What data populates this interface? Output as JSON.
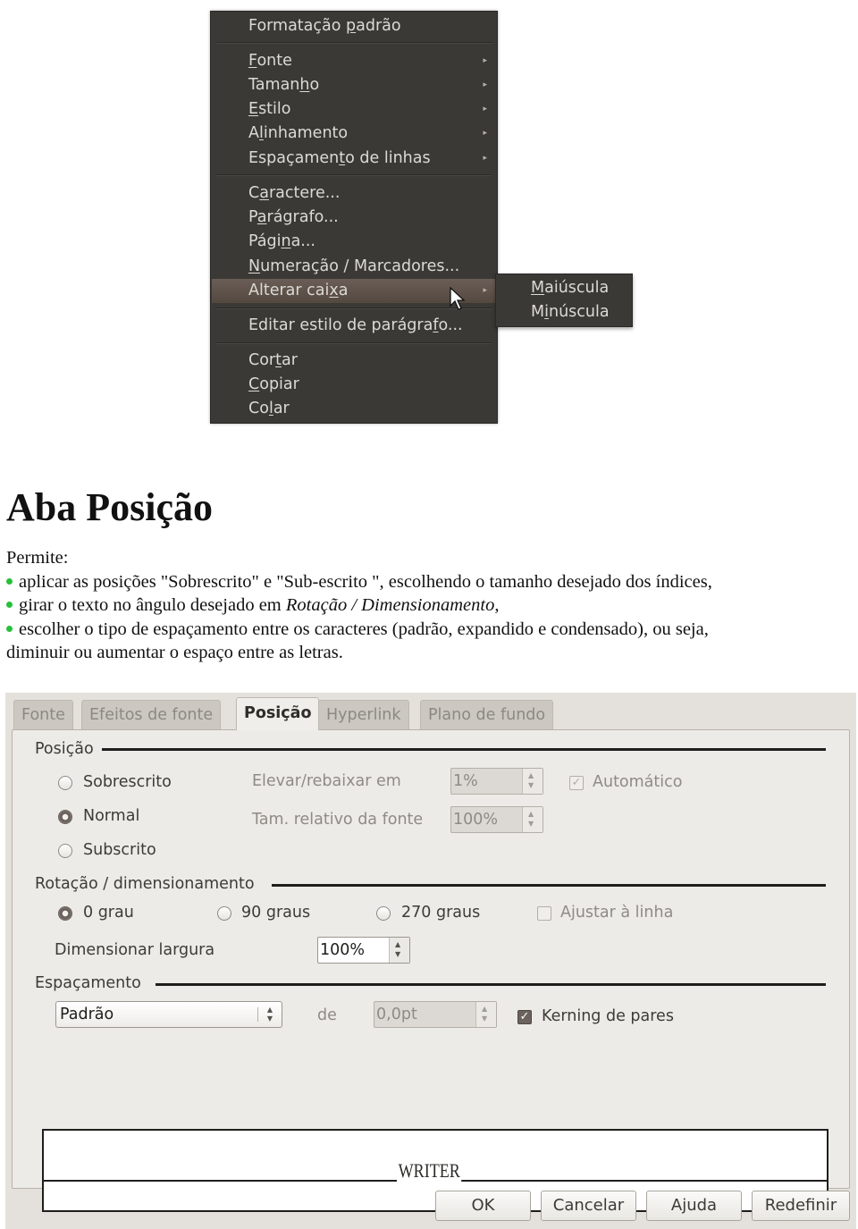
{
  "context_menu": {
    "items": [
      {
        "label": "Formatação padrão",
        "accel_index": 11,
        "submenu": false
      },
      {
        "label": "Fonte",
        "accel_index": 0,
        "submenu": true
      },
      {
        "label": "Tamanho",
        "accel_index": 5,
        "submenu": true
      },
      {
        "label": "Estilo",
        "accel_index": 0,
        "submenu": true
      },
      {
        "label": "Alinhamento",
        "accel_index": 1,
        "submenu": true
      },
      {
        "label": "Espaçamento de linhas",
        "accel_index": 9,
        "submenu": true
      },
      {
        "label": "Caractere...",
        "accel_index": 1,
        "submenu": false
      },
      {
        "label": "Parágrafo...",
        "accel_index": 1,
        "submenu": false
      },
      {
        "label": "Página...",
        "accel_index": 4,
        "submenu": false
      },
      {
        "label": "Numeração / Marcadores...",
        "accel_index": 0,
        "submenu": false
      },
      {
        "label": "Alterar caixa",
        "accel_index": 11,
        "submenu": true,
        "highlighted": true
      },
      {
        "label": "Editar estilo de parágrafo...",
        "accel_index": 24,
        "submenu": false
      },
      {
        "label": "Cortar",
        "accel_index": 3,
        "submenu": false
      },
      {
        "label": "Copiar",
        "accel_index": 0,
        "submenu": false
      },
      {
        "label": "Colar",
        "accel_index": 2,
        "submenu": false
      }
    ],
    "submenu_items": [
      {
        "label": "Maiúscula",
        "accel_index": 0
      },
      {
        "label": "Minúscula",
        "accel_index": 1
      }
    ],
    "arrow_glyph": "▸"
  },
  "document": {
    "title": "Aba Posição",
    "intro": "Permite:",
    "bullets": [
      {
        "text": "aplicar as posições \"Sobrescrito\" e \"Sub-escrito \", escolhendo o tamanho desejado dos índices,"
      },
      {
        "text_before": "girar o texto no ângulo desejado em ",
        "italic": "Rotação / Dimensionamento",
        "text_after": ","
      },
      {
        "text": "escolher o tipo de espaçamento entre os caracteres (padrão, expandido e condensado), ou seja,"
      }
    ],
    "continuation": "diminuir ou aumentar o espaço entre as letras.",
    "bullet_color": "#26c13a"
  },
  "dialog": {
    "tabs": [
      {
        "label": "Fonte",
        "active": false
      },
      {
        "label": "Efeitos de fonte",
        "active": false
      },
      {
        "label": "Posição",
        "active": true
      },
      {
        "label": "Hyperlink",
        "active": false
      },
      {
        "label": "Plano de fundo",
        "active": false
      }
    ],
    "posicao": {
      "group_label": "Posição",
      "radios": [
        {
          "label": "Sobrescrito",
          "checked": false
        },
        {
          "label": "Normal",
          "checked": true
        },
        {
          "label": "Subscrito",
          "checked": false
        }
      ],
      "raise_lower_label": "Elevar/rebaixar em",
      "raise_lower_value": "1%",
      "relative_size_label": "Tam. relativo da fonte",
      "relative_size_value": "100%",
      "automatic_label": "Automático",
      "automatic_checked": true
    },
    "rotacao": {
      "group_label": "Rotação / dimensionamento",
      "radios": [
        {
          "label": "0 grau",
          "checked": true
        },
        {
          "label": "90 graus",
          "checked": false
        },
        {
          "label": "270 graus",
          "checked": false
        }
      ],
      "fit_to_line_label": "Ajustar à linha",
      "fit_to_line_checked": false,
      "scale_width_label": "Dimensionar largura",
      "scale_width_value": "100%"
    },
    "espacamento": {
      "group_label": "Espaçamento",
      "selected": "Padrão",
      "by_label": "de",
      "by_value": "0,0pt",
      "kerning_label": "Kerning de pares",
      "kerning_checked": true
    },
    "preview_text": "WRITER",
    "buttons": {
      "ok": "OK",
      "cancel": "Cancelar",
      "help": "Ajuda",
      "reset": "Redefinir"
    }
  }
}
